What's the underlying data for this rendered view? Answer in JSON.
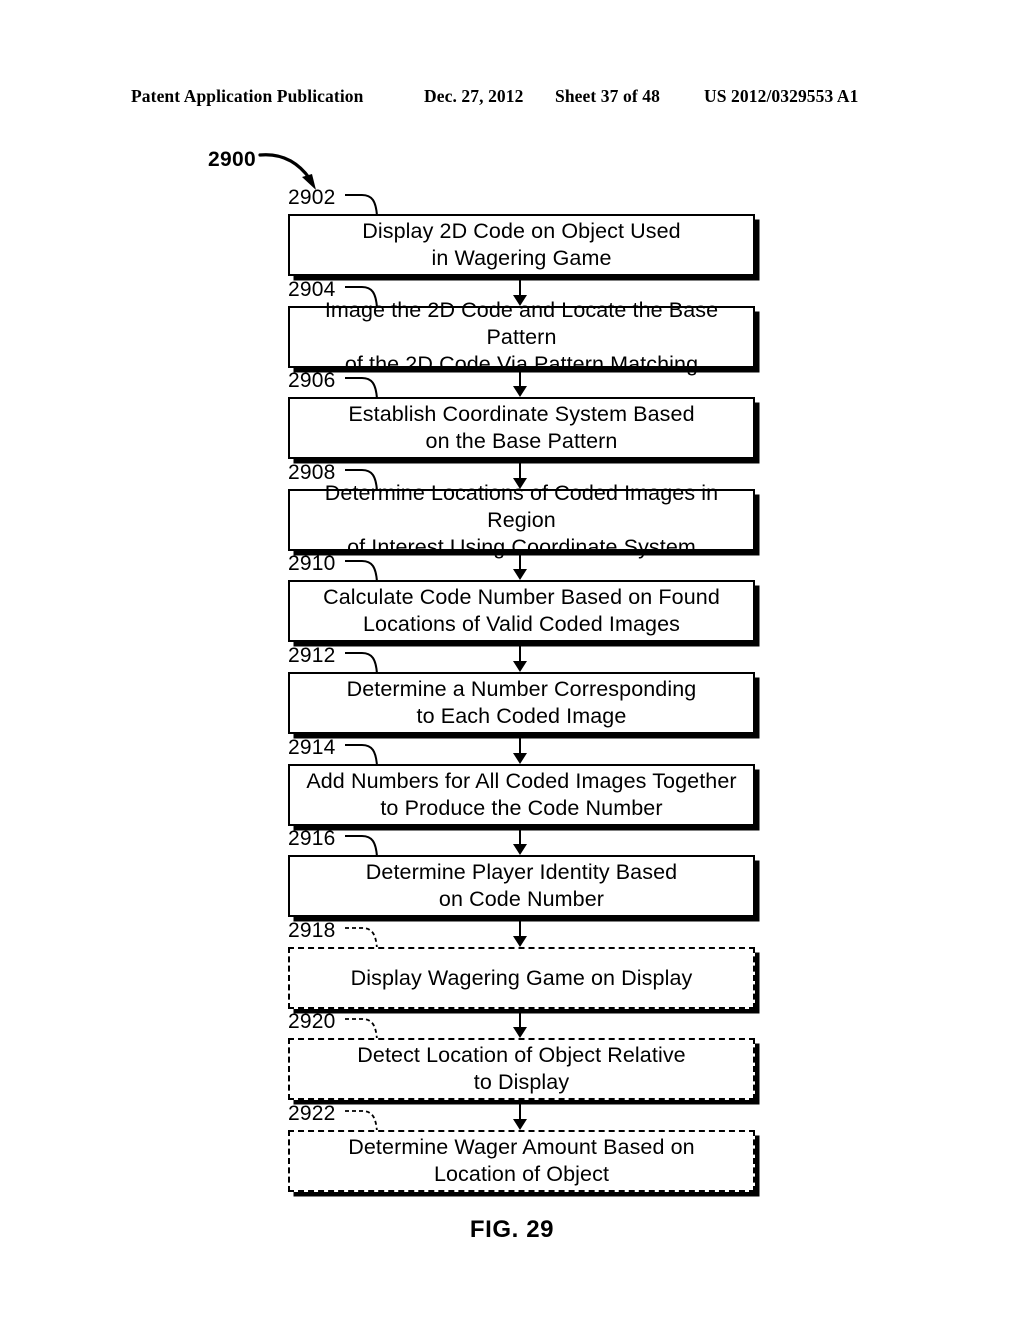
{
  "header": {
    "publication": "Patent Application Publication",
    "date": "Dec. 27, 2012",
    "sheet": "Sheet 37 of 48",
    "number": "US 2012/0329553 A1"
  },
  "figure": {
    "flow_ref": "2900",
    "caption": "FIG. 29"
  },
  "steps": [
    {
      "ref": "2902",
      "text": "Display 2D Code on Object Used\nin Wagering Game",
      "style": "solid"
    },
    {
      "ref": "2904",
      "text": "Image the 2D Code and Locate the Base Pattern\nof the 2D Code Via Pattern Matching",
      "style": "solid"
    },
    {
      "ref": "2906",
      "text": "Establish Coordinate System Based\non the Base Pattern",
      "style": "solid"
    },
    {
      "ref": "2908",
      "text": "Determine Locations of Coded Images in Region\nof Interest Using Coordinate System",
      "style": "solid"
    },
    {
      "ref": "2910",
      "text": "Calculate Code Number Based on Found\nLocations of Valid Coded Images",
      "style": "solid"
    },
    {
      "ref": "2912",
      "text": "Determine a Number Corresponding\nto Each Coded Image",
      "style": "solid"
    },
    {
      "ref": "2914",
      "text": "Add Numbers for All Coded Images Together\nto Produce the Code Number",
      "style": "solid"
    },
    {
      "ref": "2916",
      "text": "Determine Player Identity Based\non Code Number",
      "style": "solid"
    },
    {
      "ref": "2918",
      "text": "Display Wagering Game on Display",
      "style": "dashed"
    },
    {
      "ref": "2920",
      "text": "Detect Location of Object Relative\nto Display",
      "style": "dashed"
    },
    {
      "ref": "2922",
      "text": "Determine Wager Amount Based on\nLocation of Object",
      "style": "dashed"
    }
  ]
}
